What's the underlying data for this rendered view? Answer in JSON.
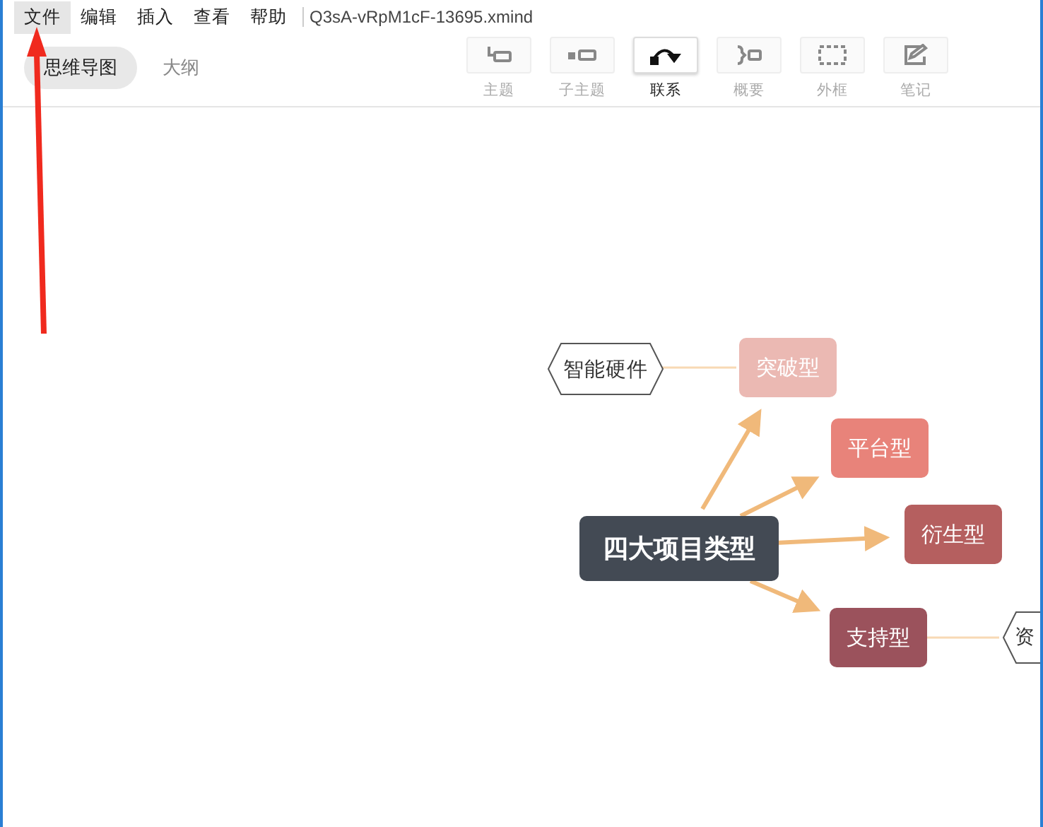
{
  "menu": [
    {
      "label": "文件",
      "selected": true
    },
    {
      "label": "编辑",
      "selected": false
    },
    {
      "label": "插入",
      "selected": false
    },
    {
      "label": "查看",
      "selected": false
    },
    {
      "label": "帮助",
      "selected": false
    }
  ],
  "file_name": "Q3sA-vRpM1cF-13695.xmind",
  "view_tabs": [
    {
      "label": "思维导图",
      "selected": true
    },
    {
      "label": "大纲",
      "selected": false
    }
  ],
  "tools": [
    {
      "kind": "topic",
      "label": "主题",
      "active": false
    },
    {
      "kind": "subtopic",
      "label": "子主题",
      "active": false
    },
    {
      "kind": "relation",
      "label": "联系",
      "active": true
    },
    {
      "kind": "summary",
      "label": "概要",
      "active": false
    },
    {
      "kind": "boundary",
      "label": "外框",
      "active": false
    },
    {
      "kind": "note",
      "label": "笔记",
      "active": false
    }
  ],
  "mind_map": {
    "central": "四大项目类型",
    "branches": [
      {
        "label": "突破型",
        "color": "#ebb9b3",
        "children": [
          {
            "label": "智能硬件"
          }
        ]
      },
      {
        "label": "平台型",
        "color": "#e8837a"
      },
      {
        "label": "衍生型",
        "color": "#b55f5f"
      },
      {
        "label": "支持型",
        "color": "#9b525c",
        "children": [
          {
            "label": "资"
          }
        ]
      }
    ]
  }
}
